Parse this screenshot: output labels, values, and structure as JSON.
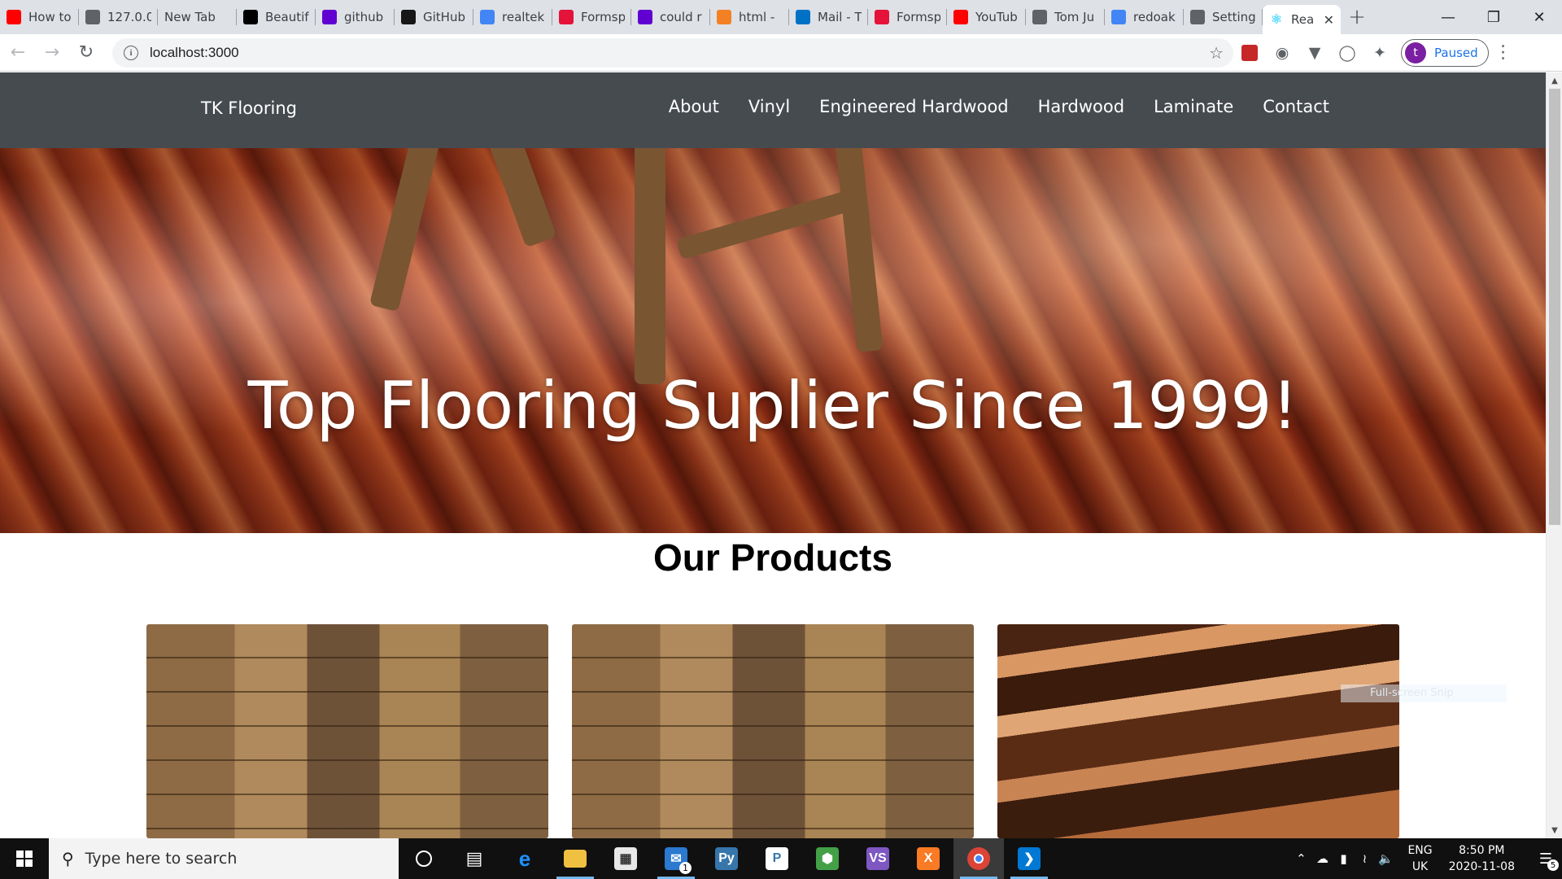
{
  "browser": {
    "tabs": [
      {
        "label": "How to",
        "favicon_color": "#ff0000",
        "icon": "youtube-icon"
      },
      {
        "label": "127.0.0",
        "favicon_color": "#5f6368",
        "icon": "globe-icon"
      },
      {
        "label": "New Tab",
        "favicon_color": "",
        "icon": ""
      },
      {
        "label": "Beautif",
        "favicon_color": "#000000",
        "icon": "unsplash-icon"
      },
      {
        "label": "github",
        "favicon_color": "#6001d2",
        "icon": "yahoo-icon"
      },
      {
        "label": "GitHub",
        "favicon_color": "#181717",
        "icon": "github-icon"
      },
      {
        "label": "realtek",
        "favicon_color": "#4285f4",
        "icon": "google-icon"
      },
      {
        "label": "Formsp",
        "favicon_color": "#e5133a",
        "icon": "formspree-icon"
      },
      {
        "label": "could r",
        "favicon_color": "#6001d2",
        "icon": "yahoo-icon"
      },
      {
        "label": "html -",
        "favicon_color": "#f48024",
        "icon": "stackoverflow-icon"
      },
      {
        "label": "Mail - T",
        "favicon_color": "#0072c6",
        "icon": "outlook-icon"
      },
      {
        "label": "Formsp",
        "favicon_color": "#e5133a",
        "icon": "formspree-icon"
      },
      {
        "label": "YouTub",
        "favicon_color": "#ff0000",
        "icon": "youtube-icon"
      },
      {
        "label": "Tom Ju",
        "favicon_color": "#5f6368",
        "icon": "globe-icon"
      },
      {
        "label": "redoak",
        "favicon_color": "#4285f4",
        "icon": "google-icon"
      },
      {
        "label": "Setting",
        "favicon_color": "#5f6368",
        "icon": "globe-icon"
      }
    ],
    "active_tab": {
      "label": "Rea",
      "favicon_color": "#61dafb",
      "icon": "react-icon"
    },
    "new_tab_label": "+",
    "url": "localhost:3000",
    "profile_initial": "t",
    "profile_status": "Paused"
  },
  "site": {
    "brand": "TK Flooring",
    "nav": [
      "About",
      "Vinyl",
      "Engineered Hardwood",
      "Hardwood",
      "Laminate",
      "Contact"
    ],
    "hero_title": "Top Flooring Suplier Since 1999!",
    "section_title": "Our Products",
    "snip_overlay": "Full-screen Snip"
  },
  "taskbar": {
    "search_placeholder": "Type here to search",
    "mail_badge": "1",
    "lang_line1": "ENG",
    "lang_line2": "UK",
    "time": "8:50 PM",
    "date": "2020-11-08",
    "notification_count": "5"
  }
}
